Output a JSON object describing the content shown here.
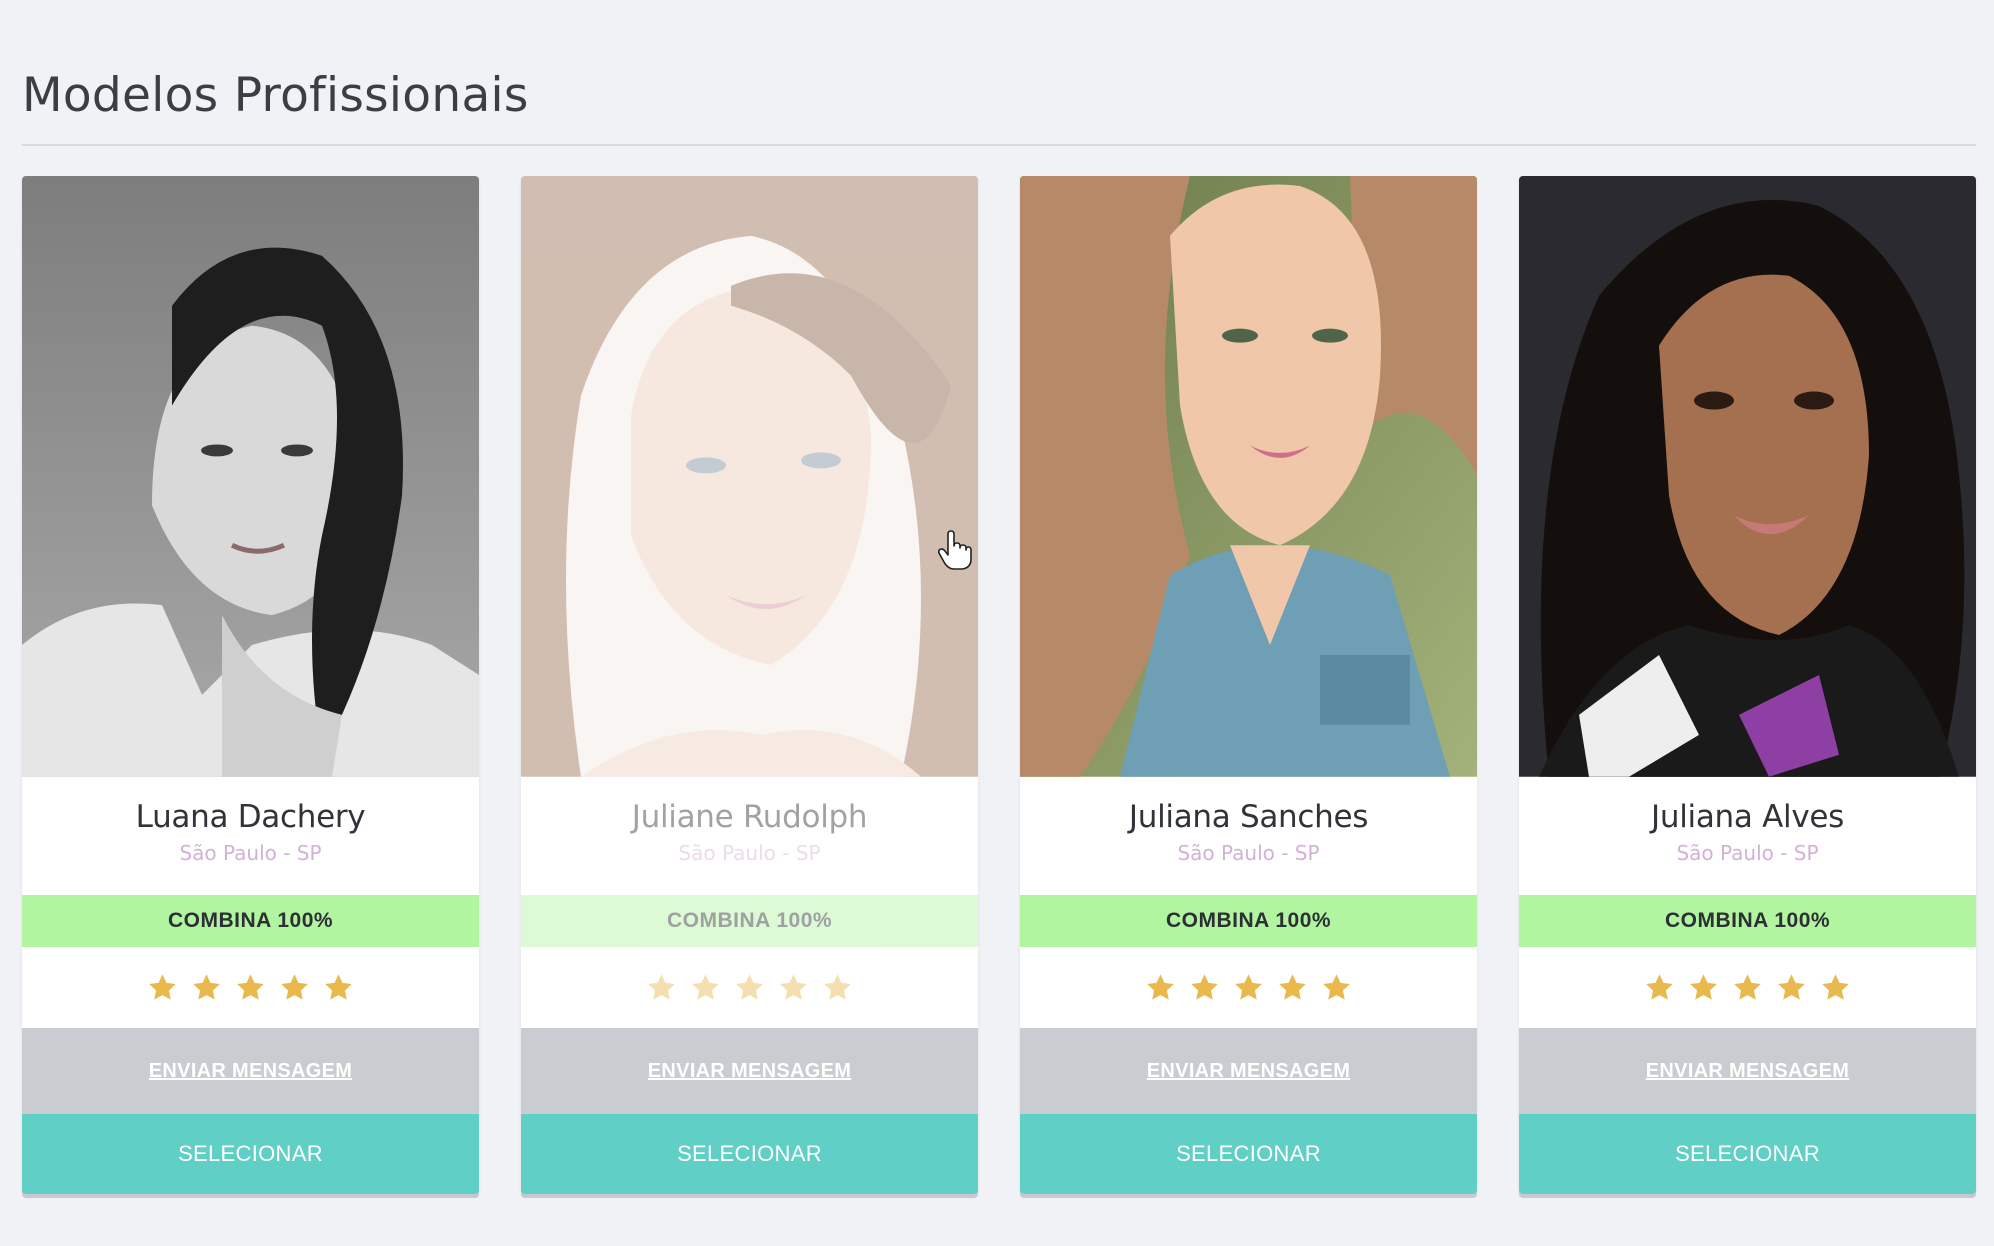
{
  "page": {
    "title": "Modelos Profissionais"
  },
  "cards": [
    {
      "name": "Luana Dachery",
      "location": "São Paulo - SP",
      "match": "COMBINA 100%",
      "rating": 5,
      "message_label": "ENVIAR MENSAGEM",
      "select_label": "SELECIONAR",
      "photo_icon": "model-photo"
    },
    {
      "name": "Juliane Rudolph",
      "location": "São Paulo - SP",
      "match": "COMBINA 100%",
      "rating": 5,
      "message_label": "ENVIAR MENSAGEM",
      "select_label": "SELECIONAR",
      "photo_icon": "model-photo"
    },
    {
      "name": "Juliana Sanches",
      "location": "São Paulo - SP",
      "match": "COMBINA 100%",
      "rating": 5,
      "message_label": "ENVIAR MENSAGEM",
      "select_label": "SELECIONAR",
      "photo_icon": "model-photo"
    },
    {
      "name": "Juliana Alves",
      "location": "São Paulo - SP",
      "match": "COMBINA 100%",
      "rating": 5,
      "message_label": "ENVIAR MENSAGEM",
      "select_label": "SELECIONAR",
      "photo_icon": "model-photo"
    }
  ],
  "colors": {
    "background": "#f1f2f6",
    "match_bar": "#b2f5a1",
    "message_button": "#c9ccd1",
    "select_button": "#60cfc6",
    "star": "#e9b94e",
    "location_text": "#d3b1d7"
  },
  "cursor": {
    "icon": "hand-pointer-icon"
  }
}
